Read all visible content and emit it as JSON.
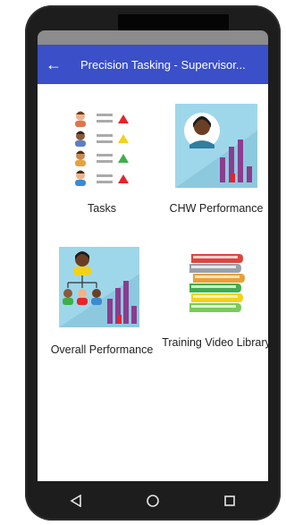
{
  "app_bar": {
    "back_icon": "back-arrow-icon",
    "title": "Precision Tasking - Supervisor..."
  },
  "tiles": [
    {
      "label": "Tasks",
      "icon": "task-list-icon"
    },
    {
      "label": "CHW Performance",
      "icon": "chw-performance-icon"
    },
    {
      "label": "Overall Performance",
      "icon": "overall-performance-icon"
    },
    {
      "label": "Training Video Library",
      "icon": "book-stack-icon"
    }
  ],
  "nav": {
    "back": "nav-back-icon",
    "home": "nav-home-icon",
    "recents": "nav-recents-icon"
  },
  "colors": {
    "app_bar": "#3a4fc8",
    "tile_bg": "#9fd7ea",
    "bar": "#8b3c8f",
    "red": "#e8232a",
    "yellow": "#f3d21b",
    "green": "#3fae4a"
  }
}
